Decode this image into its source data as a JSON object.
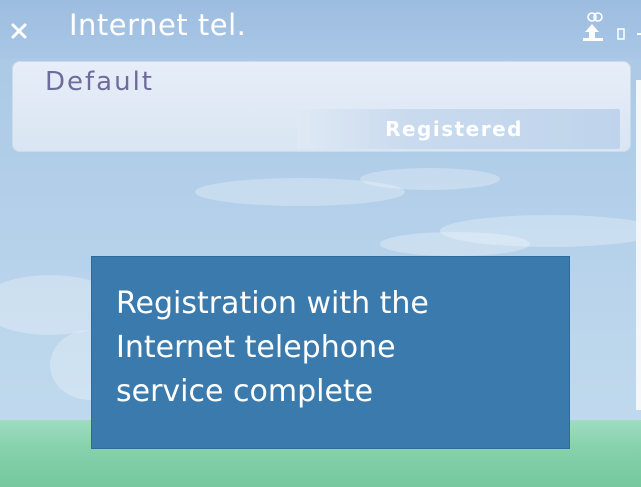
{
  "title_bar": {
    "title": "Internet tel.",
    "close_icon": "close-icon",
    "signal_icon": "signal-icon",
    "battery_icon": "battery-icon"
  },
  "service": {
    "name": "Default",
    "status": "Registered"
  },
  "note": {
    "text": "Registration with the\nInternet telephone\nservice complete"
  },
  "colors": {
    "background": "#b4d0ea",
    "panel": "#e0e9f5",
    "service_name": "#6f6c9c",
    "note_background": "#3b7aac",
    "green_band": "#86d2ad"
  }
}
